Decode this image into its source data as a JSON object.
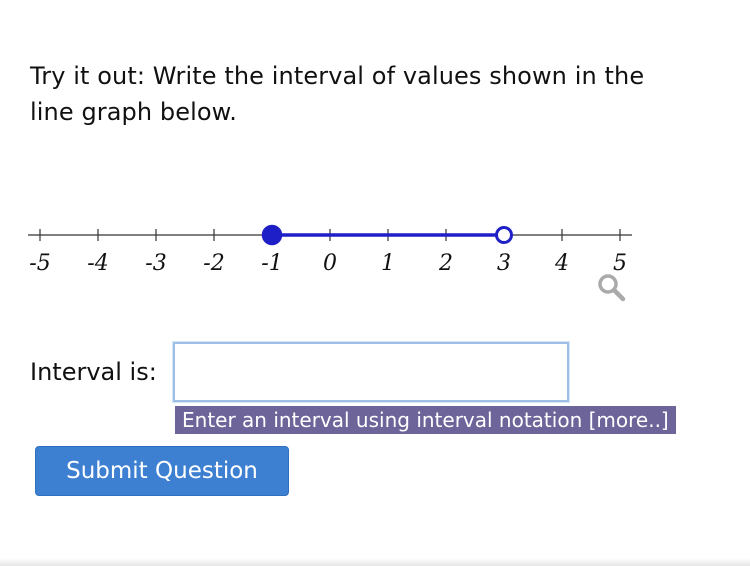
{
  "prompt": {
    "line1": "Try it out: Write the interval of values shown in the",
    "line2": "line graph below."
  },
  "number_line": {
    "tick_labels": [
      "-5",
      "-4",
      "-3",
      "-2",
      "-1",
      "0",
      "1",
      "2",
      "3",
      "4",
      "5"
    ],
    "range": [
      -5,
      5
    ],
    "interval_start": -1,
    "interval_end": 3,
    "start_closed": true,
    "end_closed": false,
    "color": "#1f1fc8",
    "zoom_icon": "magnifier-icon"
  },
  "answer": {
    "label": "Interval is:",
    "value": "",
    "hint": "Enter an interval using interval notation [more..]"
  },
  "submit_label": "Submit Question",
  "colors": {
    "button": "#3d7fd1",
    "hint_bg": "#6d649a",
    "input_border": "#9ec0e6"
  }
}
